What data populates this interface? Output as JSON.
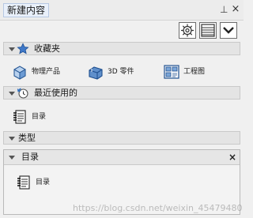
{
  "panel": {
    "title": "新建内容",
    "pin_glyph": "⊥",
    "close_glyph": "×"
  },
  "toolbar": {
    "buttons": [
      {
        "icon": "gear-icon",
        "label": "settings"
      },
      {
        "icon": "list-view-icon",
        "label": "view"
      },
      {
        "icon": "chevron-down-icon",
        "label": "options"
      }
    ]
  },
  "favorites": {
    "header": "收藏夹",
    "items": [
      {
        "label": "物理产品",
        "icon": "physical-product-icon"
      },
      {
        "label": "3D 零件",
        "icon": "3d-part-icon"
      },
      {
        "label": "工程图",
        "icon": "drawing-icon"
      }
    ]
  },
  "recent": {
    "header": "最近使用的",
    "items": [
      {
        "label": "目录",
        "icon": "catalog-icon"
      }
    ]
  },
  "types": {
    "header": "类型",
    "subpanel": {
      "header": "目录",
      "close_glyph": "×",
      "items": [
        {
          "label": "目录",
          "icon": "catalog-icon"
        }
      ]
    }
  },
  "watermark": "https://blog.csdn.net/weixin_45479480"
}
